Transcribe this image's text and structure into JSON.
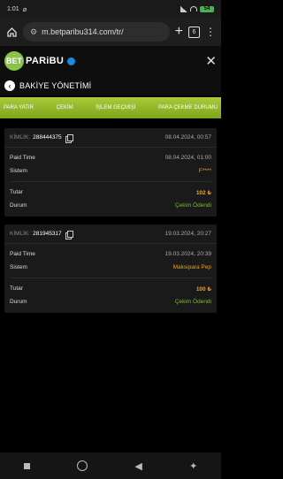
{
  "status": {
    "time": "1:01",
    "battery": "54"
  },
  "browser": {
    "url": "m.betparibu314.com/tr/",
    "tabs_count": "6"
  },
  "site": {
    "logo_bet": "BET",
    "logo_paribu": "PARiBU"
  },
  "page": {
    "title": "BAKİYE YÖNETİMİ"
  },
  "tabs": [
    {
      "label": "PARA YATIR"
    },
    {
      "label": "ÇEKİM"
    },
    {
      "label": "İŞLEM GEÇMİŞİ"
    },
    {
      "label": "PARA ÇEKME DURUMU"
    }
  ],
  "cards": [
    {
      "kimlik_label": "KİMLİK:",
      "kimlik": "288444375",
      "date": "08.04.2024, 00:57",
      "paid_time_label": "Paid Time",
      "paid_time": "08.04.2024, 01:00",
      "sistem_label": "Sistem",
      "sistem": "F****",
      "tutar_label": "Tutar",
      "tutar": "102 ₺",
      "durum_label": "Durum",
      "durum": "Çekim Ödendi"
    },
    {
      "kimlik_label": "KİMLİK:",
      "kimlik": "281945317",
      "date": "19.03.2024, 20:27",
      "paid_time_label": "Paid Time",
      "paid_time": "19.03.2024, 20:39",
      "sistem_label": "Sistem",
      "sistem": "Maksipara Pep",
      "tutar_label": "Tutar",
      "tutar": "100 ₺",
      "durum_label": "Durum",
      "durum": "Çekim Ödendi"
    }
  ],
  "colors": {
    "accent_green": "#8bc34a",
    "amount_orange": "#e8a420",
    "status_green": "#7dbb2a"
  }
}
